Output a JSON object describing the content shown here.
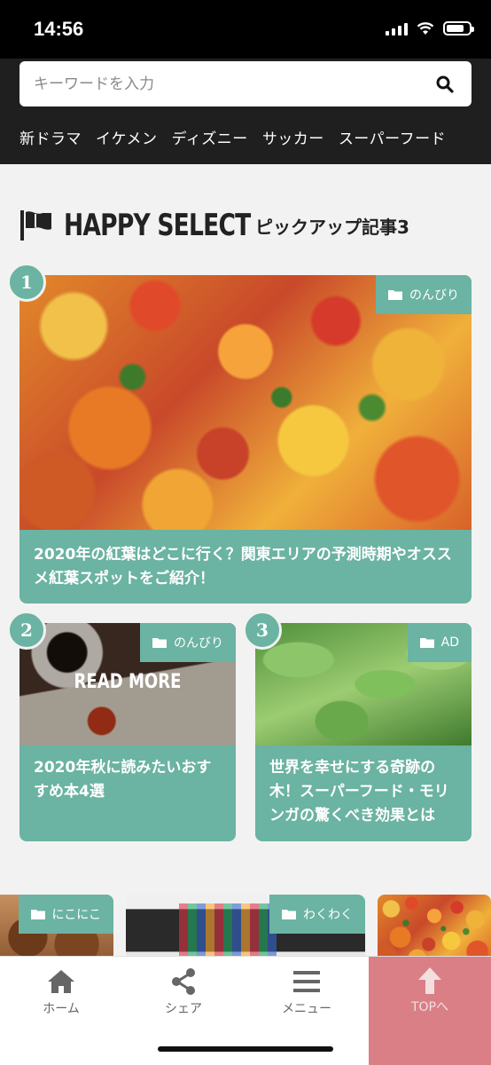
{
  "status": {
    "time": "14:56"
  },
  "search": {
    "placeholder": "キーワードを入力"
  },
  "tags": [
    "新ドラマ",
    "イケメン",
    "ディズニー",
    "サッカー",
    "スーパーフード"
  ],
  "section": {
    "title": "HAPPY SELECT",
    "subtitle": "ピックアップ記事3"
  },
  "cards": [
    {
      "rank": "1",
      "category": "のんびり",
      "title": "2020年の紅葉はどこに行く？関東エリアの予測時期やオススメ紅葉スポットをご紹介！"
    },
    {
      "rank": "2",
      "category": "のんびり",
      "overlay": "READ MORE",
      "title": "2020年秋に読みたいおすすめ本4選"
    },
    {
      "rank": "3",
      "category": "AD",
      "title": "世界を幸せにする奇跡の木！スーパーフード・モリンガの驚くべき効果とは"
    }
  ],
  "strip": [
    {
      "category": "にこにこ"
    },
    {
      "category": "わくわく"
    }
  ],
  "tabbar": {
    "home": "ホーム",
    "share": "シェア",
    "menu": "メニュー",
    "top": "TOPへ"
  },
  "colors": {
    "accent": "#6bb3a2",
    "top_button": "#da7f86",
    "header": "#1f1f1f"
  }
}
